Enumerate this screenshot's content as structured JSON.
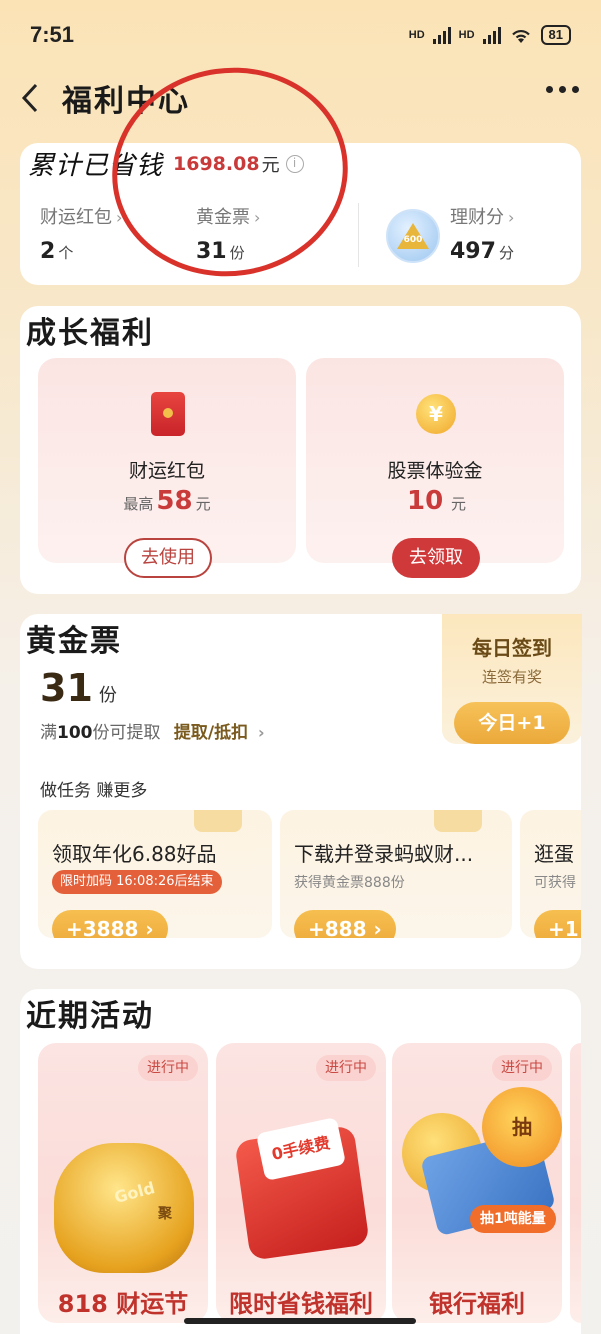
{
  "status_bar": {
    "time": "7:51",
    "battery": "81",
    "net1": "HD",
    "net2": "HD"
  },
  "nav": {
    "title": "福利中心"
  },
  "summary": {
    "label": "累计已省钱",
    "amount": "1698.08",
    "unit": "元",
    "stats": [
      {
        "label": "财运红包",
        "value": "2",
        "unit": "个"
      },
      {
        "label": "黄金票",
        "value": "31",
        "unit": "份"
      },
      {
        "label": "理财分",
        "value": "497",
        "unit": "分"
      }
    ],
    "badge_text": "600"
  },
  "growth": {
    "title": "成长福利",
    "tiles": [
      {
        "name": "财运红包",
        "prefix": "最高",
        "value": "58",
        "unit": "元",
        "button": "去使用"
      },
      {
        "name": "股票体验金",
        "value": "10",
        "unit": "元",
        "button": "去领取"
      }
    ]
  },
  "gold": {
    "title": "黄金票",
    "count": "31",
    "count_unit": "份",
    "note_prefix": "满",
    "note_num": "100",
    "note_suffix": "份可提取",
    "note_link": "提取/抵扣",
    "checkin": {
      "title": "每日签到",
      "subtitle": "连签有奖",
      "button": "今日+1"
    },
    "tasks_title": "做任务 赚更多",
    "tasks": [
      {
        "name": "领取年化6.88好品",
        "tag": "限时加码 16:08:26后结束",
        "reward": "+3888"
      },
      {
        "name": "下载并登录蚂蚁财...",
        "sub": "获得黄金票888份",
        "reward": "+888"
      },
      {
        "name": "逛蛋",
        "sub": "可获得",
        "reward": "+1"
      }
    ]
  },
  "recent": {
    "title": "近期活动",
    "activities": [
      {
        "status": "进行中",
        "name": "818 财运节",
        "art_text": "Gold",
        "art_text2": "聚"
      },
      {
        "status": "进行中",
        "name": "限时省钱福利",
        "art_text": "0手续费"
      },
      {
        "status": "进行中",
        "name": "银行福利",
        "art_text": "抽",
        "art_text2": "抽1吨能量"
      }
    ]
  },
  "colors": {
    "accent_red": "#c93a3a",
    "gold": "#f0b040",
    "annotation_red": "#d9322b"
  }
}
